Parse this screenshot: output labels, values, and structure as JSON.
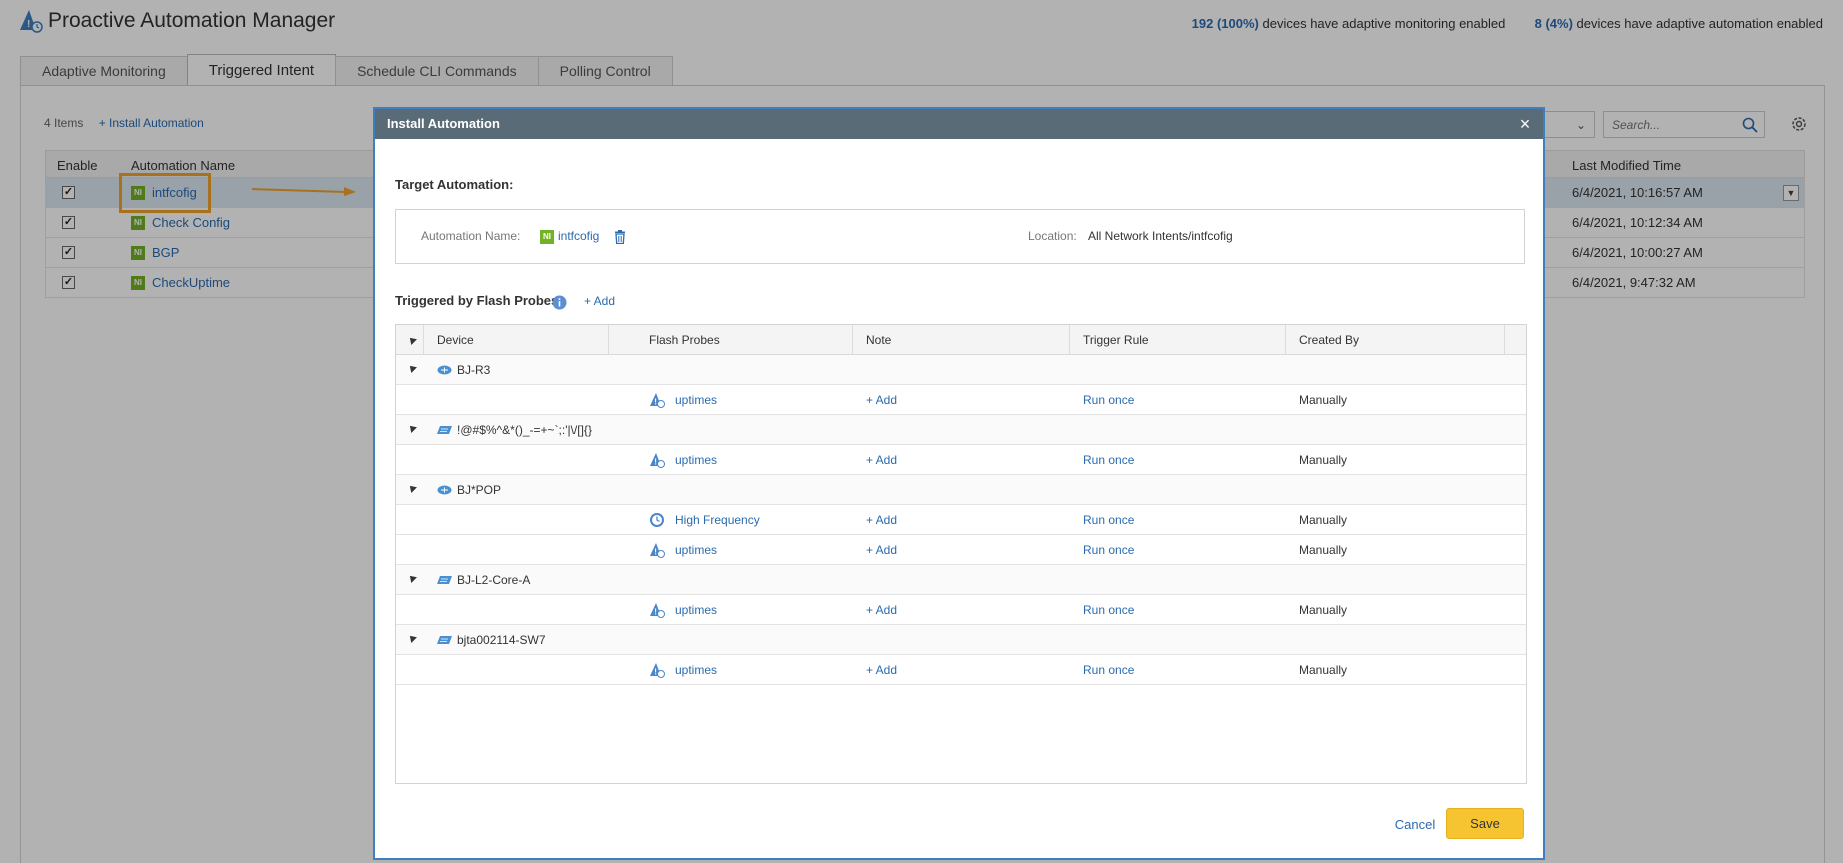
{
  "app": {
    "title": "Proactive Automation Manager",
    "stats": {
      "monitoring_count": "192 (100%)",
      "monitoring_text": "devices have adaptive monitoring enabled",
      "automation_count": "8 (4%)",
      "automation_text": "devices have adaptive automation enabled"
    },
    "tabs": [
      {
        "label": "Adaptive Monitoring"
      },
      {
        "label": "Triggered Intent"
      },
      {
        "label": "Schedule CLI Commands"
      },
      {
        "label": "Polling Control"
      }
    ],
    "active_tab": "Triggered Intent",
    "toolbar": {
      "count": "4 Items",
      "install_label": "+ Install Automation"
    },
    "search": {
      "placeholder": "Search..."
    },
    "grid": {
      "headers": {
        "enable": "Enable",
        "name": "Automation Name",
        "time": "Last Modified Time"
      },
      "rows": [
        {
          "enabled": "✓",
          "icon": "NI",
          "name": "intfcofig",
          "time": "6/4/2021, 10:16:57 AM"
        },
        {
          "enabled": "✓",
          "icon": "NI",
          "name": "Check Config",
          "time": "6/4/2021, 10:12:34 AM"
        },
        {
          "enabled": "✓",
          "icon": "NI",
          "name": "BGP",
          "time": "6/4/2021, 10:00:27 AM"
        },
        {
          "enabled": "✓",
          "icon": "NI",
          "name": "CheckUptime",
          "time": "6/4/2021, 9:47:32 AM"
        }
      ]
    },
    "colors": {
      "accent": "#2a6bb0",
      "highlight": "#f0a32a",
      "ni_green": "#72b225"
    }
  },
  "modal": {
    "title": "Install Automation",
    "close_icon": "×",
    "target_title": "Target Automation:",
    "automation_name_label": "Automation Name:",
    "automation_name_icon": "NI",
    "automation_name": "intfcofig",
    "location_label": "Location:",
    "location_value": "All Network Intents/intfcofig",
    "probes_title": "Triggered by Flash Probes",
    "add_label": "+ Add",
    "table": {
      "headers": {
        "device": "Device",
        "flash_probes": "Flash Probes",
        "note": "Note",
        "trigger_rule": "Trigger Rule",
        "created_by": "Created By"
      },
      "groups": [
        {
          "device": "BJ-R3",
          "device_icon": "router-icon",
          "probes": [
            {
              "name": "uptimes",
              "icon": "alert-probe-icon",
              "note": "+ Add",
              "rule": "Run once",
              "created_by": "Manually"
            }
          ]
        },
        {
          "device": "!@#$%^&*()_-=+~`;:'|\\/[]{}",
          "device_icon": "switch-icon",
          "probes": [
            {
              "name": "uptimes",
              "icon": "alert-probe-icon",
              "note": "+ Add",
              "rule": "Run once",
              "created_by": "Manually"
            }
          ]
        },
        {
          "device": "BJ*POP",
          "device_icon": "router-icon",
          "probes": [
            {
              "name": "High Frequency",
              "icon": "clock-probe-icon",
              "note": "+ Add",
              "rule": "Run once",
              "created_by": "Manually"
            },
            {
              "name": "uptimes",
              "icon": "alert-probe-icon",
              "note": "+ Add",
              "rule": "Run once",
              "created_by": "Manually"
            }
          ]
        },
        {
          "device": "BJ-L2-Core-A",
          "device_icon": "switch-icon",
          "probes": [
            {
              "name": "uptimes",
              "icon": "alert-probe-icon",
              "note": "+ Add",
              "rule": "Run once",
              "created_by": "Manually"
            }
          ]
        },
        {
          "device": "bjta002114-SW7",
          "device_icon": "switch-icon",
          "probes": [
            {
              "name": "uptimes",
              "icon": "alert-probe-icon",
              "note": "+ Add",
              "rule": "Run once",
              "created_by": "Manually"
            }
          ]
        }
      ]
    },
    "cancel_label": "Cancel",
    "save_label": "Save"
  }
}
